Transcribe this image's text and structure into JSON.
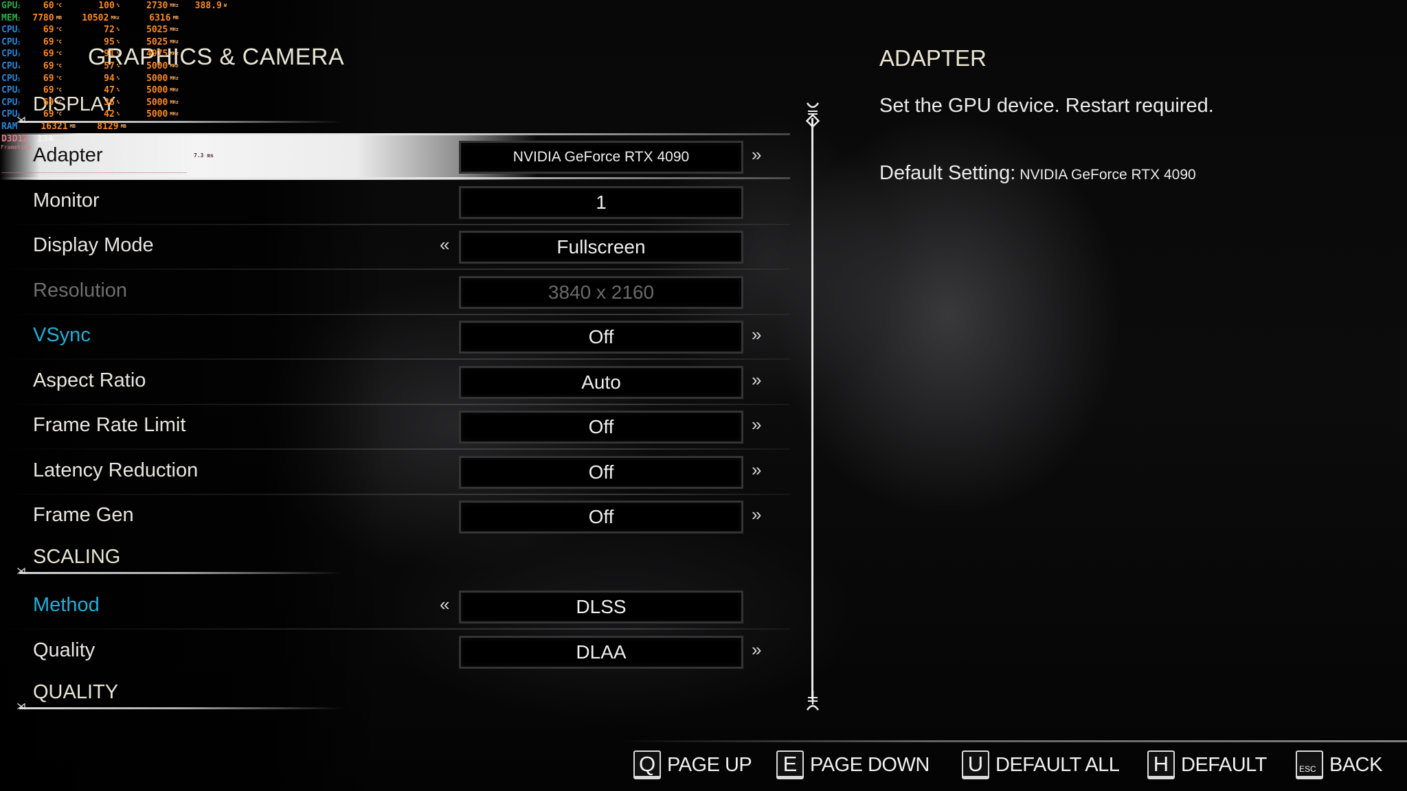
{
  "hud": {
    "rows": [
      {
        "label": "GPU",
        "sub": "2",
        "color": "green",
        "cols": [
          [
            "60",
            "°C"
          ],
          [
            "100",
            "%"
          ],
          [
            "2730",
            "MHz"
          ],
          [
            "388.9",
            "W"
          ]
        ]
      },
      {
        "label": "MEM",
        "sub": "2",
        "color": "green",
        "cols": [
          [
            "7780",
            "MB"
          ],
          [
            "10502",
            "MHz"
          ],
          [
            "6316",
            "MB"
          ],
          [
            "",
            ""
          ]
        ]
      },
      {
        "label": "CPU",
        "sub": "1",
        "color": "blue",
        "cols": [
          [
            "69",
            "°C"
          ],
          [
            "72",
            "%"
          ],
          [
            "5025",
            "MHz"
          ],
          [
            "",
            ""
          ]
        ]
      },
      {
        "label": "CPU",
        "sub": "2",
        "color": "blue",
        "cols": [
          [
            "69",
            "°C"
          ],
          [
            "95",
            "%"
          ],
          [
            "5025",
            "MHz"
          ],
          [
            "",
            ""
          ]
        ]
      },
      {
        "label": "CPU",
        "sub": "3",
        "color": "blue",
        "cols": [
          [
            "69",
            "°C"
          ],
          [
            "91",
            "%"
          ],
          [
            "4975",
            "MHz"
          ],
          [
            "",
            ""
          ]
        ]
      },
      {
        "label": "CPU",
        "sub": "4",
        "color": "blue",
        "cols": [
          [
            "69",
            "°C"
          ],
          [
            "57",
            "%"
          ],
          [
            "5000",
            "MHz"
          ],
          [
            "",
            ""
          ]
        ]
      },
      {
        "label": "CPU",
        "sub": "5",
        "color": "blue",
        "cols": [
          [
            "69",
            "°C"
          ],
          [
            "94",
            "%"
          ],
          [
            "5000",
            "MHz"
          ],
          [
            "",
            ""
          ]
        ]
      },
      {
        "label": "CPU",
        "sub": "6",
        "color": "blue",
        "cols": [
          [
            "69",
            "°C"
          ],
          [
            "47",
            "%"
          ],
          [
            "5000",
            "MHz"
          ],
          [
            "",
            ""
          ]
        ]
      },
      {
        "label": "CPU",
        "sub": "7",
        "color": "blue",
        "cols": [
          [
            "69",
            "°C"
          ],
          [
            "36",
            "%"
          ],
          [
            "5000",
            "MHz"
          ],
          [
            "",
            ""
          ]
        ]
      },
      {
        "label": "CPU",
        "sub": "8",
        "color": "blue",
        "cols": [
          [
            "69",
            "°C"
          ],
          [
            "42",
            "%"
          ],
          [
            "5000",
            "MHz"
          ],
          [
            "",
            ""
          ]
        ]
      },
      {
        "label": "RAM",
        "sub": "",
        "color": "blue",
        "cols": [
          [
            "16321",
            "MB"
          ],
          [
            "8129",
            "MB"
          ],
          [
            "",
            ""
          ],
          [
            "",
            ""
          ]
        ]
      },
      {
        "label": "D3D12",
        "sub": "",
        "color": "pink",
        "cols": [
          [
            "134",
            "FPS"
          ],
          [
            "",
            ""
          ],
          [
            "",
            ""
          ],
          [
            "",
            ""
          ]
        ]
      }
    ],
    "frametime_label": "Frametime",
    "frametime_value": "7.3 ms"
  },
  "page_title": "GRAPHICS & CAMERA",
  "sections": {
    "display": "DISPLAY",
    "scaling": "SCALING",
    "quality": "QUALITY"
  },
  "settings": [
    {
      "label": "Adapter",
      "value": "NVIDIA GeForce RTX 4090",
      "left_arrow": false,
      "right_arrow": true,
      "state": "selected"
    },
    {
      "label": "Monitor",
      "value": "1",
      "left_arrow": false,
      "right_arrow": false,
      "state": "normal"
    },
    {
      "label": "Display Mode",
      "value": "Fullscreen",
      "left_arrow": true,
      "right_arrow": false,
      "state": "normal"
    },
    {
      "label": "Resolution",
      "value": "3840 x 2160",
      "left_arrow": false,
      "right_arrow": false,
      "state": "disabled"
    },
    {
      "label": "VSync",
      "value": "Off",
      "left_arrow": false,
      "right_arrow": true,
      "state": "accent"
    },
    {
      "label": "Aspect Ratio",
      "value": "Auto",
      "left_arrow": false,
      "right_arrow": true,
      "state": "normal"
    },
    {
      "label": "Frame Rate Limit",
      "value": "Off",
      "left_arrow": false,
      "right_arrow": true,
      "state": "normal"
    },
    {
      "label": "Latency Reduction",
      "value": "Off",
      "left_arrow": false,
      "right_arrow": true,
      "state": "normal"
    },
    {
      "label": "Frame Gen",
      "value": "Off",
      "left_arrow": false,
      "right_arrow": true,
      "state": "normal"
    },
    {
      "label": "Method",
      "value": "DLSS",
      "left_arrow": true,
      "right_arrow": false,
      "state": "accent"
    },
    {
      "label": "Quality",
      "value": "DLAA",
      "left_arrow": false,
      "right_arrow": true,
      "state": "normal"
    }
  ],
  "arrows": {
    "left": "«",
    "right": "»"
  },
  "info": {
    "title": "ADAPTER",
    "description": "Set the GPU device. Restart required.",
    "default_label": "Default Setting:",
    "default_value": "NVIDIA GeForce RTX 4090"
  },
  "footer": [
    {
      "key": "Q",
      "label": "PAGE UP"
    },
    {
      "key": "E",
      "label": "PAGE DOWN"
    },
    {
      "key": "U",
      "label": "DEFAULT ALL"
    },
    {
      "key": "H",
      "label": "DEFAULT"
    },
    {
      "key": "ESC",
      "label": "BACK"
    }
  ],
  "colors": {
    "accent": "#1fb0d8",
    "hud_value": "#ff8a1e",
    "hud_gpu": "#2fae4a",
    "hud_cpu": "#2a86d6"
  }
}
